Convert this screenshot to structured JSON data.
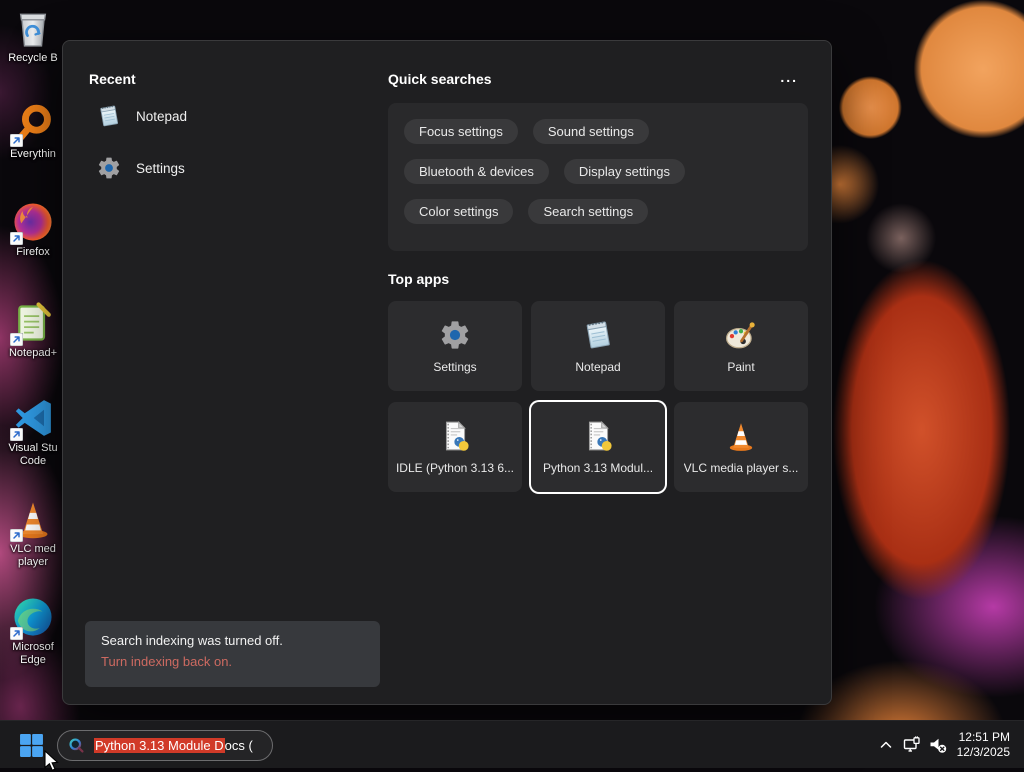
{
  "desktop": {
    "icons": [
      {
        "id": "recycle-bin",
        "icon": "recycle-bin-icon",
        "label": "Recycle B"
      },
      {
        "id": "everything",
        "icon": "magnifier-orange-icon",
        "label": "Everythin"
      },
      {
        "id": "firefox",
        "icon": "firefox-icon",
        "label": "Firefox"
      },
      {
        "id": "notepad-plus-plus",
        "icon": "notepad-plus-plus-icon",
        "label": "Notepad+"
      },
      {
        "id": "visual-studio-code",
        "icon": "vscode-icon",
        "label": "Visual Stu\nCode"
      },
      {
        "id": "vlc-media-player",
        "icon": "vlc-cone-icon",
        "label": "VLC med\nplayer"
      },
      {
        "id": "microsoft-edge",
        "icon": "edge-icon",
        "label": "Microsof\nEdge"
      }
    ]
  },
  "search_panel": {
    "recent": {
      "title": "Recent",
      "items": [
        {
          "label": "Notepad",
          "icon": "notepad-icon"
        },
        {
          "label": "Settings",
          "icon": "gear-icon"
        }
      ]
    },
    "quick_searches": {
      "title": "Quick searches",
      "more_label": "...",
      "pills": [
        "Focus settings",
        "Sound settings",
        "Bluetooth & devices",
        "Display settings",
        "Color settings",
        "Search settings"
      ]
    },
    "top_apps": {
      "title": "Top apps",
      "tiles": [
        {
          "label": "Settings",
          "icon": "gear-icon",
          "selected": false
        },
        {
          "label": "Notepad",
          "icon": "notepad-icon",
          "selected": false
        },
        {
          "label": "Paint",
          "icon": "paint-palette-icon",
          "selected": false
        },
        {
          "label": "IDLE (Python 3.13 6...",
          "icon": "python-doc-icon",
          "selected": false
        },
        {
          "label": "Python 3.13 Modul...",
          "icon": "python-doc-icon",
          "selected": true
        },
        {
          "label": "VLC media player s...",
          "icon": "vlc-cone-icon",
          "selected": false
        }
      ]
    },
    "indexing_notice": {
      "line1": "Search indexing was turned off.",
      "link": "Turn indexing back on."
    }
  },
  "taskbar": {
    "search_box": {
      "selected_text": "Python 3.13 Module D",
      "rest_text": "ocs (",
      "icon": "search-colored-icon"
    },
    "tray": {
      "time": "12:51 PM",
      "date": "12/3/2025",
      "icons": [
        "chevron-up-icon",
        "network-icon",
        "volume-muted-icon"
      ]
    }
  },
  "colors": {
    "selection_red": "#d13a28",
    "notice_link_red": "#cd6a61",
    "selected_tile_border": "#ffffff",
    "start_blue": "#4ba5f2",
    "panel_bg": "#1f1f21",
    "card_bg": "#29292b",
    "tile_bg": "#2c2c2e",
    "pill_bg": "#39393b",
    "taskbar_bg": "#1b1b1d"
  }
}
